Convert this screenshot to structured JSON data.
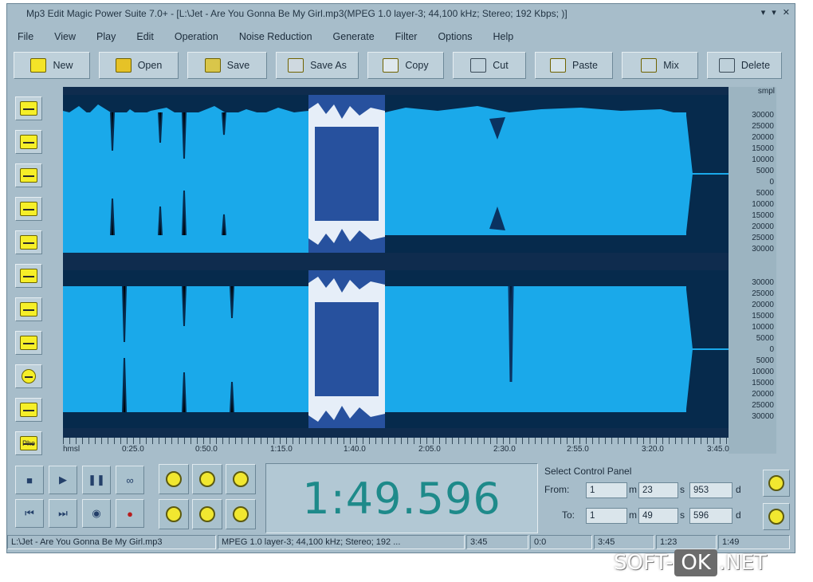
{
  "window": {
    "title": "Mp3 Edit Magic Power Suite 7.0+ - [L:\\Jet - Are You Gonna Be My Girl.mp3(MPEG 1.0 layer-3; 44,100 kHz; Stereo; 192 Kbps; )]",
    "controls": [
      "▾",
      "▾",
      "✕"
    ]
  },
  "menu": [
    "File",
    "View",
    "Play",
    "Edit",
    "Operation",
    "Noise Reduction",
    "Generate",
    "Filter",
    "Options",
    "Help"
  ],
  "toolbar": [
    {
      "label": "New",
      "icon": "new-file-icon"
    },
    {
      "label": "Open",
      "icon": "open-folder-icon"
    },
    {
      "label": "Save",
      "icon": "save-disk-icon"
    },
    {
      "label": "Save As",
      "icon": "save-as-icon"
    },
    {
      "label": "Copy",
      "icon": "copy-icon"
    },
    {
      "label": "Cut",
      "icon": "scissors-icon"
    },
    {
      "label": "Paste",
      "icon": "paste-icon"
    },
    {
      "label": "Mix",
      "icon": "mix-icon"
    },
    {
      "label": "Delete",
      "icon": "delete-icon"
    }
  ],
  "sidebar_tools": [
    "fade-in-icon",
    "fade-out-icon",
    "amplify-icon",
    "normalize-icon",
    "envelope-icon",
    "echo-icon",
    "reverse-icon",
    "invert-icon",
    "info-icon",
    "insert-silence-icon",
    "pitch-icon"
  ],
  "sidebar_last_label": "Pho",
  "waveform": {
    "selection_start": "1:23.953",
    "selection_end": "1:49.596",
    "total_duration": "3:45"
  },
  "amplitude_scale": {
    "unit": "smpl",
    "labels": [
      "30000",
      "25000",
      "20000",
      "15000",
      "10000",
      "5000",
      "0",
      "5000",
      "10000",
      "15000",
      "20000",
      "25000",
      "30000"
    ]
  },
  "time_ruler": {
    "labels": [
      "hmsl",
      "0:25.0",
      "0:50.0",
      "1:15.0",
      "1:40.0",
      "2:05.0",
      "2:30.0",
      "2:55.0",
      "3:20.0",
      "3:45.0"
    ]
  },
  "transport": {
    "buttons": [
      "stop",
      "play",
      "pause",
      "loop",
      "go-start",
      "go-end",
      "play-selection",
      "record"
    ]
  },
  "clock": {
    "value": "1:49.596"
  },
  "select_panel": {
    "title": "Select Control Panel",
    "from_label": "From:",
    "to_label": "To:",
    "from": {
      "h": "1",
      "m": "23",
      "s": "953"
    },
    "to": {
      "h": "1",
      "m": "49",
      "s": "596"
    },
    "unit_m": "m",
    "unit_s": "s",
    "unit_d": "d"
  },
  "status": {
    "file": "L:\\Jet - Are You Gonna Be My Girl.mp3",
    "format": "MPEG 1.0 layer-3; 44,100 kHz; Stereo; 192 ...",
    "length": "3:45",
    "cursor": "0:0",
    "view_end": "3:45",
    "sel_start": "1:23",
    "sel_end": "1:49"
  },
  "watermark": {
    "part1": "SOFT-",
    "part2": "OK",
    "part3": ".NET"
  }
}
